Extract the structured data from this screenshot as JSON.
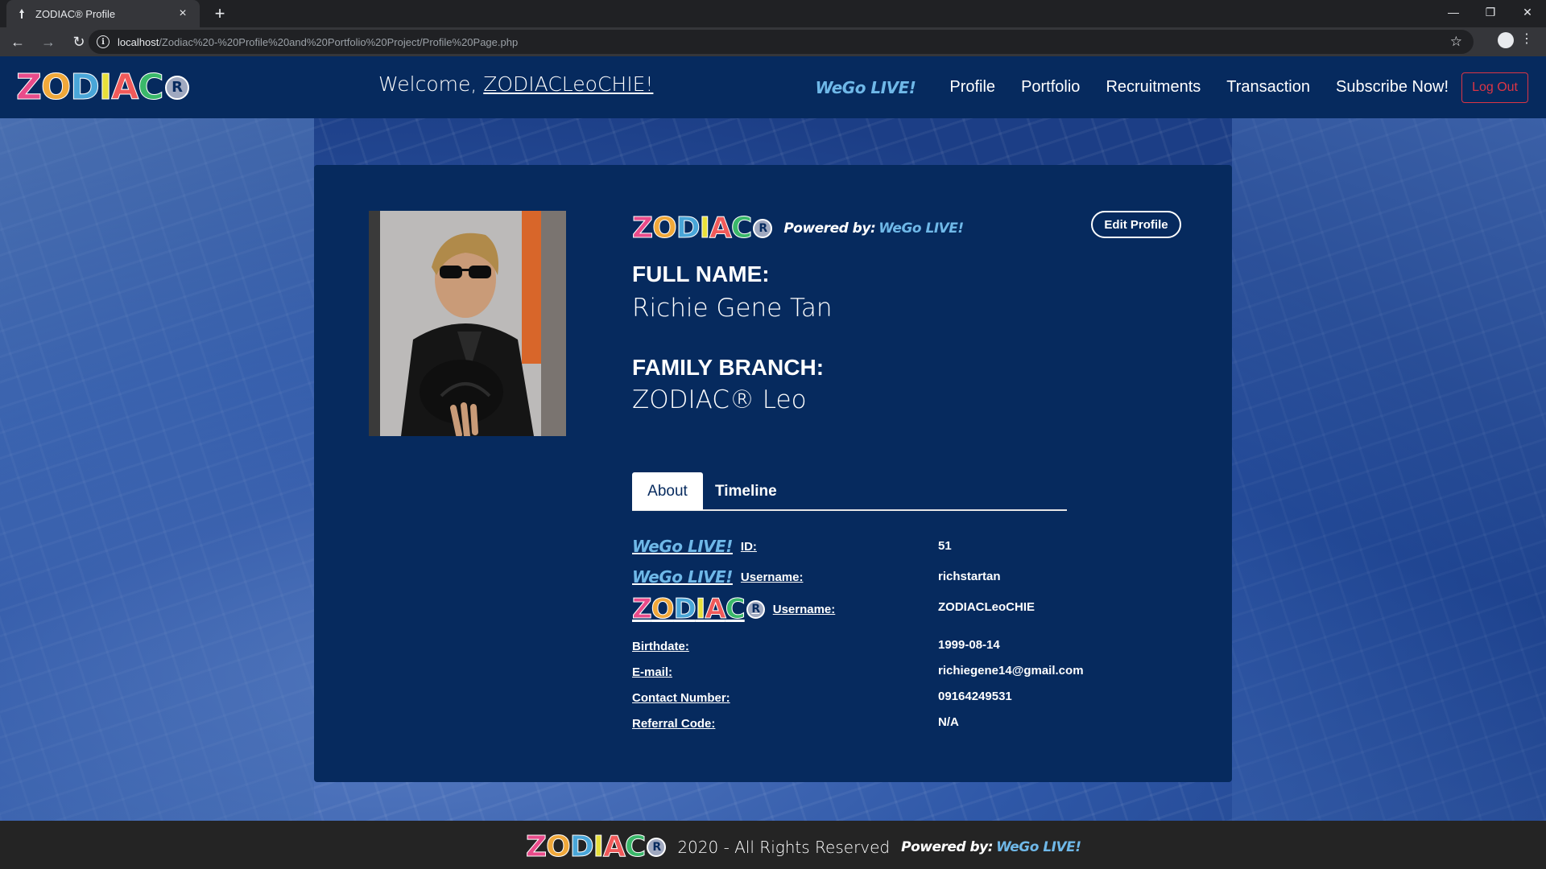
{
  "browser": {
    "tab_title": "ZODIAC® Profile",
    "url_host": "localhost",
    "url_path": "/Zodiac%20-%20Profile%20and%20Portfolio%20Project/Profile%20Page.php"
  },
  "logo": {
    "letters": [
      "Z",
      "O",
      "D",
      "I",
      "A",
      "C"
    ],
    "letter_colors": [
      "#e94b8a",
      "#f0a83a",
      "#49a6d8",
      "#e8e03a",
      "#f05a5a",
      "#3ab86a"
    ],
    "reg_mark": "R",
    "wego_text": "WeGo LIVE!",
    "powered_text": "Powered by:"
  },
  "navbar": {
    "welcome_prefix": "Welcome, ",
    "welcome_user": "ZODIACLeoCHIE!",
    "links": [
      "Profile",
      "Portfolio",
      "Recruitments",
      "Transaction",
      "Subscribe Now!"
    ],
    "logout": "Log Out"
  },
  "profile": {
    "edit_button": "Edit Profile",
    "full_name_label": "FULL NAME:",
    "full_name": "Richie Gene Tan",
    "family_branch_label": "FAMILY BRANCH:",
    "family_branch": "ZODIAC® Leo"
  },
  "tabs": {
    "about": "About",
    "timeline": "Timeline"
  },
  "details": {
    "id_label": "ID:",
    "id_value": "51",
    "wego_username_label": "Username:",
    "wego_username_value": "richstartan",
    "zodiac_username_label": "Username:",
    "zodiac_username_value": "ZODIACLeoCHIE",
    "birthdate_label": "Birthdate:",
    "birthdate_value": "1999-08-14",
    "email_label": "E-mail:",
    "email_value": "richiegene14@gmail.com",
    "contact_label": "Contact Number:",
    "contact_value": "09164249531",
    "referral_label": "Referral Code:",
    "referral_value": "N/A"
  },
  "footer": {
    "text": "2020 - All Rights Reserved"
  }
}
